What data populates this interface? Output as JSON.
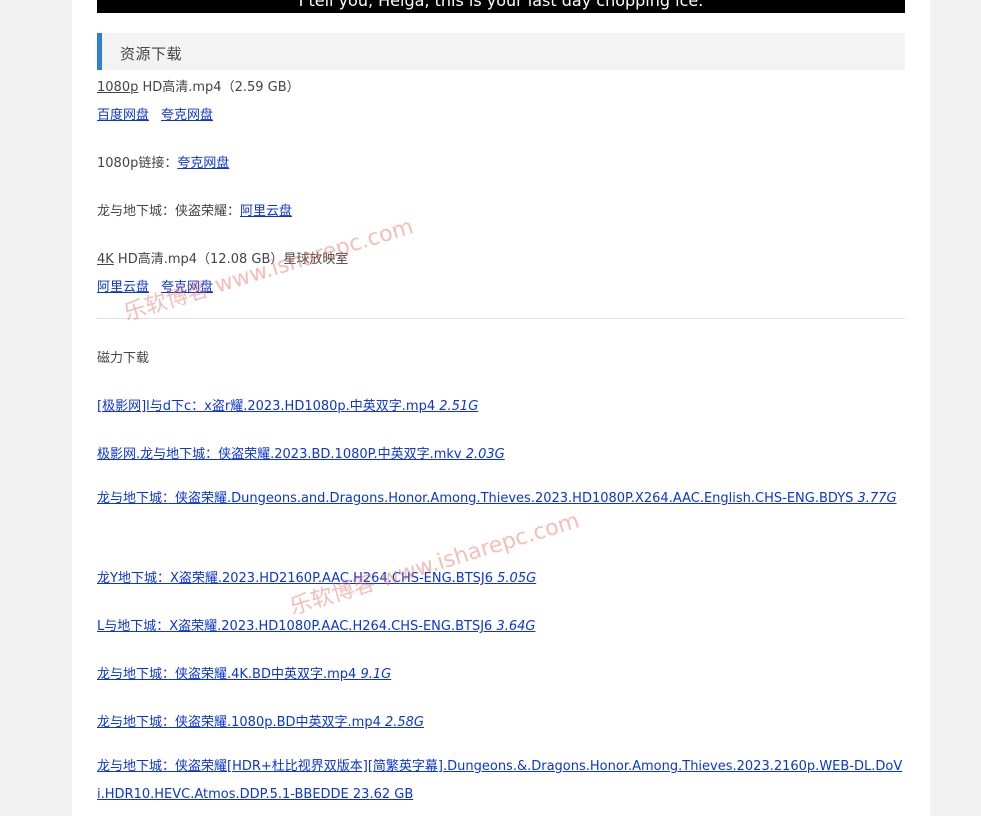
{
  "video": {
    "caption": "I tell you, Helga, this is your last day chopping ice."
  },
  "section": {
    "title": "资源下载"
  },
  "downloads": {
    "item1": {
      "quality": "1080p",
      "desc": " HD高清.mp4（2.59 GB）",
      "links": [
        "百度网盘",
        "夸克网盘"
      ]
    },
    "item2": {
      "label": "1080p链接：",
      "link": "夸克网盘"
    },
    "item3": {
      "label": "龙与地下城：侠盗荣耀：",
      "link": "阿里云盘"
    },
    "item4": {
      "quality": "4K",
      "desc": " HD高清.mp4（12.08 GB）星球放映室",
      "links": [
        "阿里云盘",
        "夸克网盘"
      ]
    }
  },
  "magnet": {
    "heading": "磁力下载",
    "items": [
      {
        "name": "[极影网]l与d下c：x盗r耀.2023.HD1080p.中英双字.mp4 ",
        "size": "2.51G"
      },
      {
        "name": "极影网.龙与地下城：侠盗荣耀.2023.BD.1080P.中英双字.mkv ",
        "size": "2.03G"
      },
      {
        "name": "龙与地下城：侠盗荣耀.Dungeons.and.Dragons.Honor.Among.Thieves.2023.HD1080P.X264.AAC.English.CHS-ENG.BDYS ",
        "size": "3.77G"
      },
      {
        "name": "龙Y地下城：X盗荣耀.2023.HD2160P.AAC.H264.CHS-ENG.BTSJ6 ",
        "size": "5.05G"
      },
      {
        "name": "L与地下城：X盗荣耀.2023.HD1080P.AAC.H264.CHS-ENG.BTSJ6 ",
        "size": "3.64G"
      },
      {
        "name": "龙与地下城：侠盗荣耀.4K.BD中英双字.mp4 ",
        "size": "9.1G"
      },
      {
        "name": "龙与地下城：侠盗荣耀.1080p.BD中英双字.mp4 ",
        "size": "2.58G"
      },
      {
        "name": "龙与地下城：侠盗荣耀[HDR+杜比视界双版本][简繁英字幕].Dungeons.&.Dragons.Honor.Among.Thieves.2023.2160p.WEB-DL.DoVi.HDR10.HEVC.Atmos.DDP.5.1-BBEDDE ",
        "size": "23.62 GB"
      }
    ]
  },
  "watermark": {
    "text": "乐软博客 www.isharepc.com"
  },
  "colors": {
    "link": "#0b35d8",
    "accent": "#2f7fd3",
    "watermark": "#e76e5f"
  }
}
